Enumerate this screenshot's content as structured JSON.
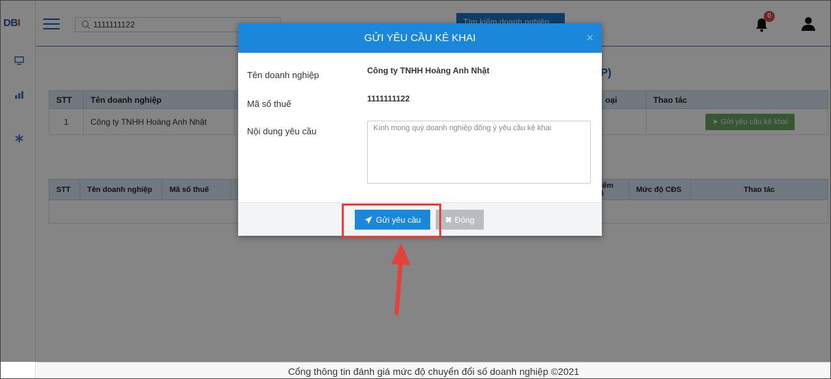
{
  "app": {
    "logo_part1": "DB",
    "logo_part2": "I"
  },
  "header": {
    "search_value": "1111111122",
    "search_button_label": "Tìm kiếm doanh nghiệp",
    "notification_count": "0"
  },
  "page": {
    "heading_fragment": "P)"
  },
  "table1": {
    "headers": [
      "STT",
      "Tên doanh nghiệp",
      "oại",
      "Thao tác"
    ],
    "rows": [
      {
        "stt": "1",
        "name": "Công ty TNHH Hoàng Anh Nhật",
        "action": "Gửi yêu cầu kê khai"
      }
    ]
  },
  "table2": {
    "headers": [
      "STT",
      "Tên doanh nghiệp",
      "Mã số thuế",
      "Điểm số",
      "Mức độ CĐS",
      "Thao tác"
    ]
  },
  "modal": {
    "title": "GỬI YÊU CẦU KÊ KHAI",
    "company_label": "Tên doanh nghiệp",
    "company_value": "Công ty TNHH Hoàng Anh Nhật",
    "tax_label": "Mã số thuế",
    "tax_value": "1111111122",
    "content_label": "Nội dung yêu cầu",
    "content_placeholder": "Kính mong quý doanh nghiệp đồng ý yêu cầu kê khai",
    "send_label": "Gửi yêu cầu",
    "close_label": "Đóng"
  },
  "footer": {
    "text": "Cổng thông tin đánh giá mức độ chuyển đổi số doanh nghiệp ©2021"
  },
  "colors": {
    "primary": "#1a87db",
    "highlight": "#e2413c",
    "success": "#68a665"
  }
}
